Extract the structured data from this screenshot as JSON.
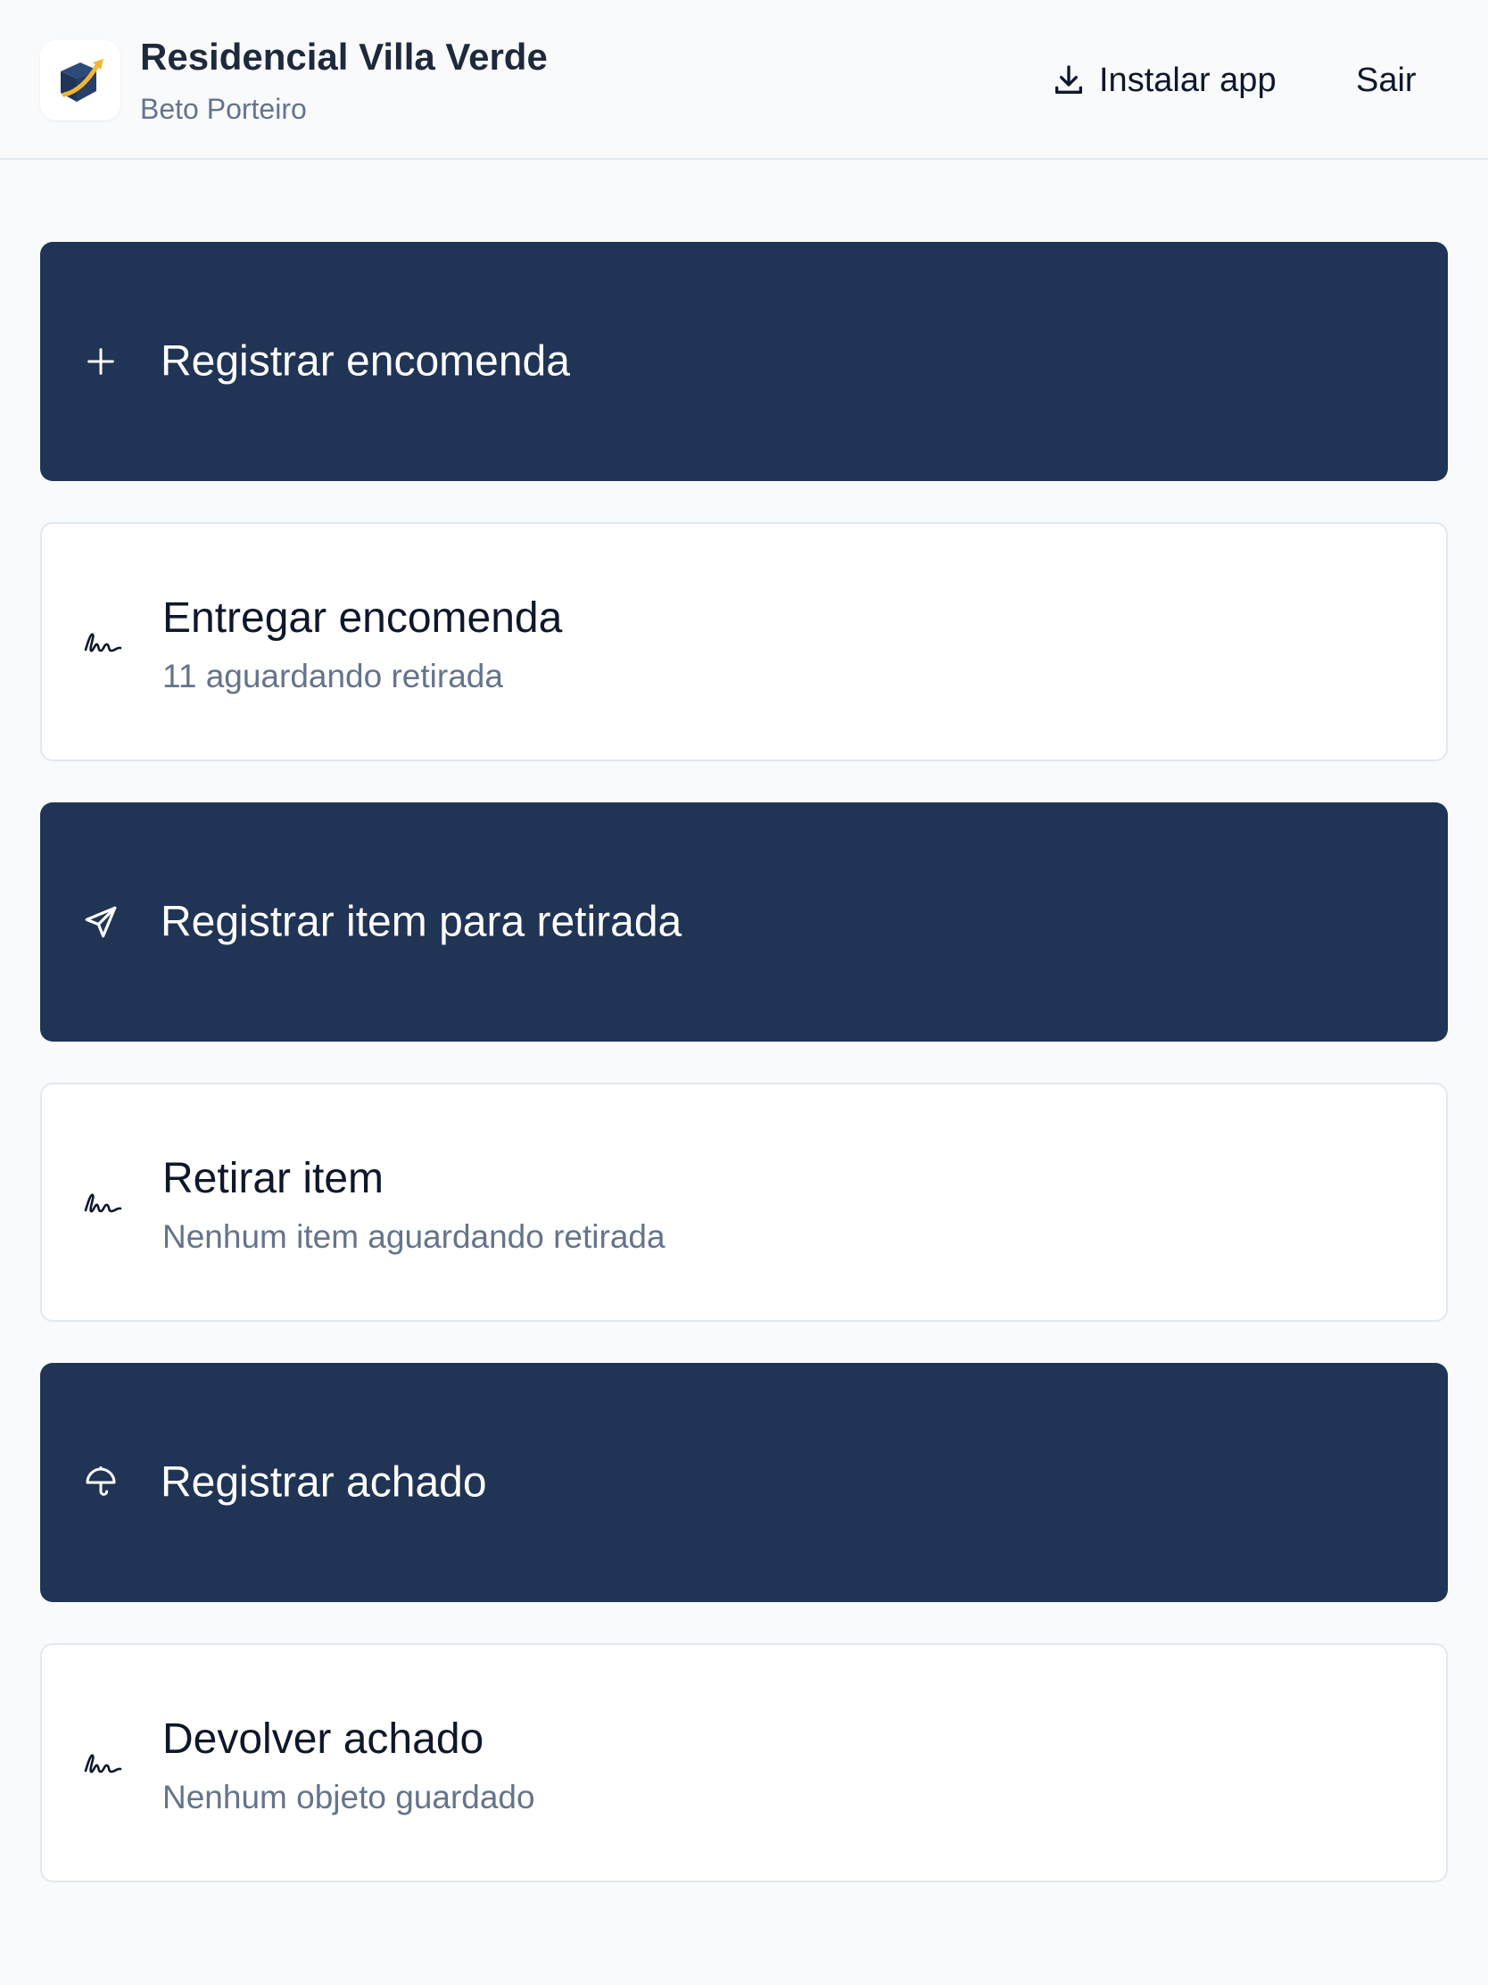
{
  "header": {
    "title": "Residencial Villa Verde",
    "subtitle": "Beto Porteiro",
    "install_label": "Instalar app",
    "logout_label": "Sair"
  },
  "actions": [
    {
      "title": "Registrar encomenda",
      "icon": "plus-icon",
      "style": "primary"
    },
    {
      "title": "Entregar encomenda",
      "subtitle": "11 aguardando retirada",
      "icon": "signature-icon",
      "style": "secondary"
    },
    {
      "title": "Registrar item para retirada",
      "icon": "send-icon",
      "style": "primary"
    },
    {
      "title": "Retirar item",
      "subtitle": "Nenhum item aguardando retirada",
      "icon": "signature-icon",
      "style": "secondary"
    },
    {
      "title": "Registrar achado",
      "icon": "umbrella-icon",
      "style": "primary"
    },
    {
      "title": "Devolver achado",
      "subtitle": "Nenhum objeto guardado",
      "icon": "signature-icon",
      "style": "secondary"
    }
  ],
  "colors": {
    "primary": "#203455",
    "background": "#f8fafc",
    "muted_text": "#64748b",
    "logo_accent": "#f2b632"
  }
}
